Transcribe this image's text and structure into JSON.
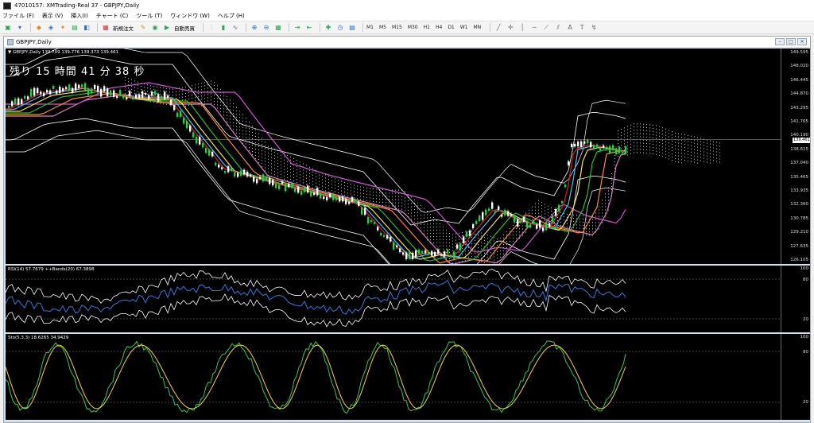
{
  "window": {
    "title": "47010157: XMTrading-Real 37 - GBPJPY,Daily"
  },
  "menu": [
    "ファイル (F)",
    "表示 (V)",
    "挿入(I)",
    "チャート (C)",
    "ツール (T)",
    "ウィンドウ (W)",
    "ヘルプ (H)"
  ],
  "toolbar": {
    "new_order": "新規注文",
    "auto_trading": "自動売買",
    "timeframes": [
      "M1",
      "M5",
      "M15",
      "M30",
      "H1",
      "H4",
      "D1",
      "W1",
      "MN"
    ]
  },
  "chart_window": {
    "title": "GBPJPY,Daily"
  },
  "main_pane": {
    "info": "▼ GBPJPY,Daily  139.709 139.776 139.373 139.461",
    "timer": "残り 15 時間 41 分 38 秒",
    "price_labels": [
      "149.595",
      "148.020",
      "146.445",
      "144.870",
      "143.295",
      "141.765",
      "140.190",
      "138.615",
      "137.040",
      "135.465",
      "133.935",
      "132.360",
      "130.785",
      "129.210",
      "127.635",
      "126.105"
    ],
    "current_price": "139.461",
    "price_range": [
      126.105,
      149.595
    ]
  },
  "rsi_pane": {
    "info": "RSI(14) 57.7679  ++Bands(20) 67.3898",
    "levels": [
      "100",
      "80",
      "20",
      "0"
    ]
  },
  "stoch_pane": {
    "info": "Sto(5,3,3) 18.6265 34.9429",
    "levels": [
      "100",
      "80",
      "20",
      "0"
    ]
  },
  "colors": {
    "background": "#000000",
    "bull_candle": "#2ecc40",
    "bear_candle": "#ffffff",
    "ma_red": "#e31a1a",
    "ma_cyan": "#33c8ff",
    "ma_yellow": "#ffe633",
    "ma_green": "#1fc41f",
    "ma_orange": "#ff8c1a",
    "ma_magenta": "#d84fd8",
    "ma_pink": "#e07ac8",
    "bollinger": "#ffffff",
    "cloud": "#c8c8c8",
    "rsi_line": "#2c7be0",
    "stoch_main": "#2ecc40",
    "stoch_signal": "#ffd700"
  }
}
